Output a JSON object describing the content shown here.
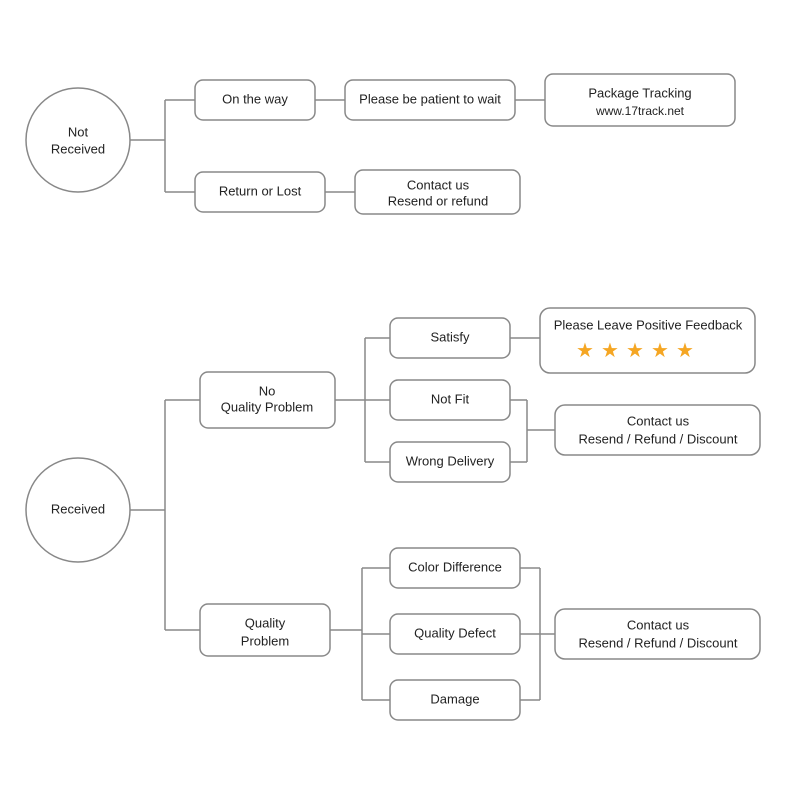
{
  "nodes": {
    "not_received": {
      "label": "Not\nReceived"
    },
    "received": {
      "label": "Received"
    },
    "on_the_way": {
      "label": "On the way"
    },
    "return_or_lost": {
      "label": "Return or Lost"
    },
    "contact_resend_refund": {
      "label": "Contact us\nResend or refund"
    },
    "package_tracking": {
      "label": "Package Tracking\nwww.17track.net"
    },
    "please_be_patient": {
      "label": "Please be patient to wait"
    },
    "no_quality_problem": {
      "label": "No\nQuality Problem"
    },
    "quality_problem": {
      "label": "Quality Problem"
    },
    "satisfy": {
      "label": "Satisfy"
    },
    "not_fit": {
      "label": "Not Fit"
    },
    "wrong_delivery": {
      "label": "Wrong Delivery"
    },
    "color_difference": {
      "label": "Color Difference"
    },
    "quality_defect": {
      "label": "Quality Defect"
    },
    "damage": {
      "label": "Damage"
    },
    "positive_feedback": {
      "label": "Please Leave Positive Feedback"
    },
    "contact_resend_refund_discount": {
      "label": "Contact us\nResend / Refund / Discount"
    }
  }
}
